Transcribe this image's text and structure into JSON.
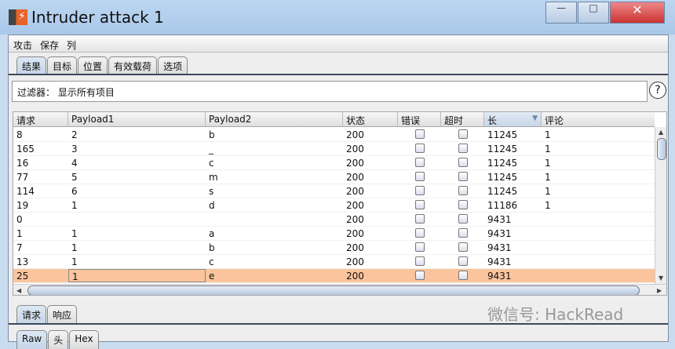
{
  "window": {
    "title": "Intruder attack 1",
    "minimize": "—",
    "maximize": "□",
    "close": "✕"
  },
  "menu": [
    "攻击",
    "保存",
    "列"
  ],
  "tabs": [
    "结果",
    "目标",
    "位置",
    "有效载荷",
    "选项"
  ],
  "filter": {
    "label": "过滤器：",
    "value": "显示所有项目"
  },
  "help": "?",
  "columns": [
    "请求",
    "Payload1",
    "Payload2",
    "状态",
    "错误",
    "超时",
    "长",
    "评论"
  ],
  "sort_indicator": "▼",
  "rows": [
    {
      "req": "8",
      "p1": "2",
      "p2": "b",
      "status": "200",
      "len": "11245",
      "comment": "1"
    },
    {
      "req": "165",
      "p1": "3",
      "p2": "_",
      "status": "200",
      "len": "11245",
      "comment": "1"
    },
    {
      "req": "16",
      "p1": "4",
      "p2": "c",
      "status": "200",
      "len": "11245",
      "comment": "1"
    },
    {
      "req": "77",
      "p1": "5",
      "p2": "m",
      "status": "200",
      "len": "11245",
      "comment": "1"
    },
    {
      "req": "114",
      "p1": "6",
      "p2": "s",
      "status": "200",
      "len": "11245",
      "comment": "1"
    },
    {
      "req": "19",
      "p1": "1",
      "p2": "d",
      "status": "200",
      "len": "11186",
      "comment": "1"
    },
    {
      "req": "0",
      "p1": "",
      "p2": "",
      "status": "200",
      "len": "9431",
      "comment": ""
    },
    {
      "req": "1",
      "p1": "1",
      "p2": "a",
      "status": "200",
      "len": "9431",
      "comment": ""
    },
    {
      "req": "7",
      "p1": "1",
      "p2": "b",
      "status": "200",
      "len": "9431",
      "comment": ""
    },
    {
      "req": "13",
      "p1": "1",
      "p2": "c",
      "status": "200",
      "len": "9431",
      "comment": ""
    },
    {
      "req": "25",
      "p1": "1",
      "p2": "e",
      "status": "200",
      "len": "9431",
      "comment": ""
    }
  ],
  "selected_row": 10,
  "bottom_tabs": [
    "请求",
    "响应"
  ],
  "view_tabs": [
    "Raw",
    "头",
    "Hex"
  ],
  "watermark": "微信号: HackRead"
}
